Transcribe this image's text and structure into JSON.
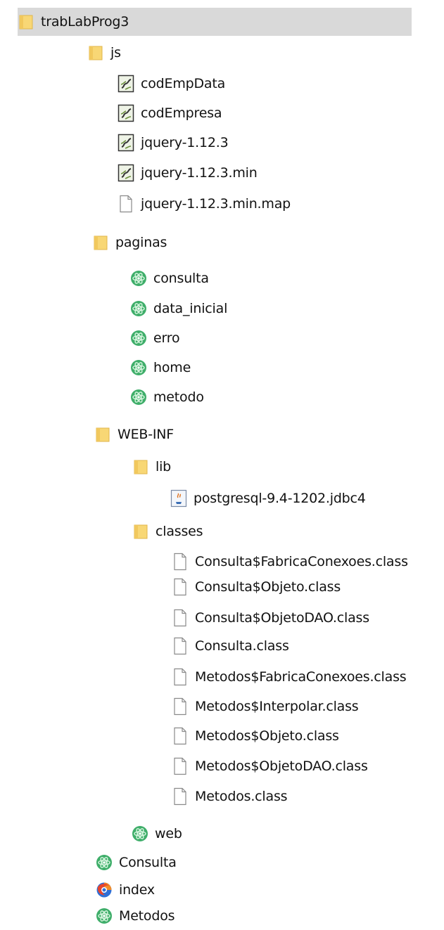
{
  "tree": {
    "items": [
      {
        "label": "trabLabProg3",
        "icon": "folder-icon",
        "selected": true
      },
      {
        "label": "js",
        "icon": "folder-icon"
      },
      {
        "label": "codEmpData",
        "icon": "script-file-icon"
      },
      {
        "label": "codEmpresa",
        "icon": "script-file-icon"
      },
      {
        "label": "jquery-1.12.3",
        "icon": "script-file-icon"
      },
      {
        "label": "jquery-1.12.3.min",
        "icon": "script-file-icon"
      },
      {
        "label": "jquery-1.12.3.min.map",
        "icon": "blank-file-icon"
      },
      {
        "label": "paginas",
        "icon": "folder-icon"
      },
      {
        "label": "consulta",
        "icon": "atom-file-icon"
      },
      {
        "label": "data_inicial",
        "icon": "atom-file-icon"
      },
      {
        "label": "erro",
        "icon": "atom-file-icon"
      },
      {
        "label": "home",
        "icon": "atom-file-icon"
      },
      {
        "label": "metodo",
        "icon": "atom-file-icon"
      },
      {
        "label": "WEB-INF",
        "icon": "folder-icon"
      },
      {
        "label": "lib",
        "icon": "folder-icon"
      },
      {
        "label": "postgresql-9.4-1202.jdbc4",
        "icon": "java-jar-icon"
      },
      {
        "label": "classes",
        "icon": "folder-icon"
      },
      {
        "label": "Consulta$FabricaConexoes.class",
        "icon": "blank-file-icon"
      },
      {
        "label": "Consulta$Objeto.class",
        "icon": "blank-file-icon"
      },
      {
        "label": "Consulta$ObjetoDAO.class",
        "icon": "blank-file-icon"
      },
      {
        "label": "Consulta.class",
        "icon": "blank-file-icon"
      },
      {
        "label": "Metodos$FabricaConexoes.class",
        "icon": "blank-file-icon"
      },
      {
        "label": "Metodos$Interpolar.class",
        "icon": "blank-file-icon"
      },
      {
        "label": "Metodos$Objeto.class",
        "icon": "blank-file-icon"
      },
      {
        "label": "Metodos$ObjetoDAO.class",
        "icon": "blank-file-icon"
      },
      {
        "label": "Metodos.class",
        "icon": "blank-file-icon"
      },
      {
        "label": "web",
        "icon": "atom-file-icon"
      },
      {
        "label": "Consulta",
        "icon": "atom-file-icon"
      },
      {
        "label": "index",
        "icon": "browser-icon"
      },
      {
        "label": "Metodos",
        "icon": "atom-file-icon"
      }
    ]
  }
}
